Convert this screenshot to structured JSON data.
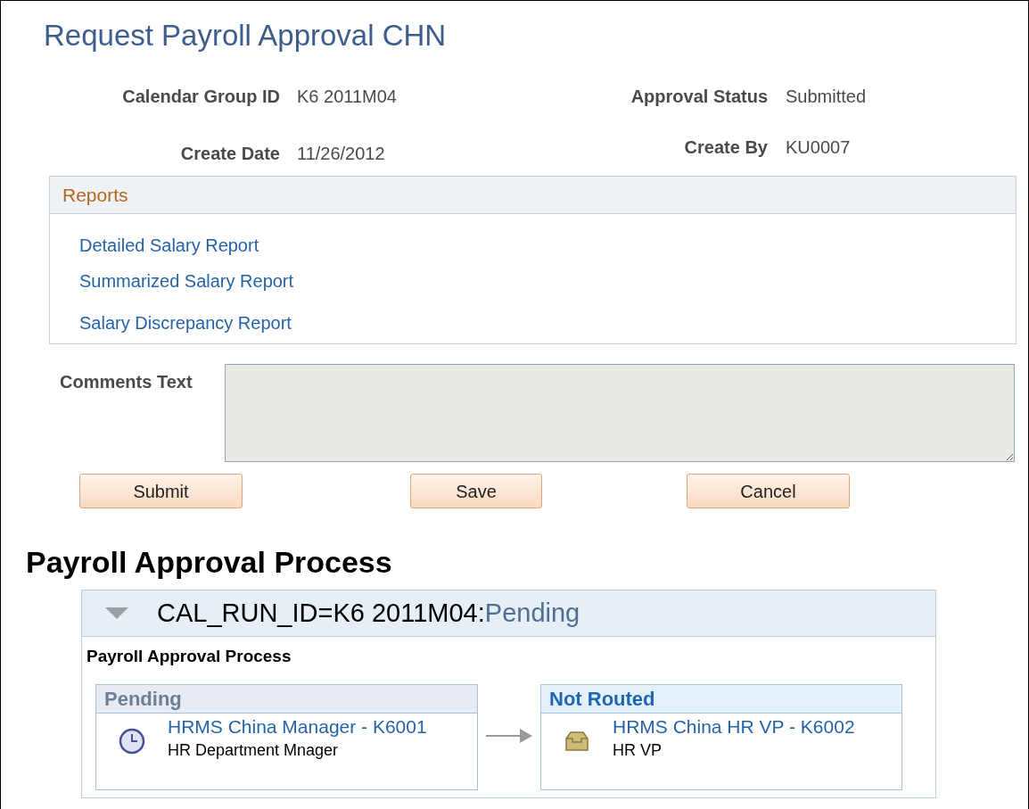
{
  "page_title": "Request Payroll Approval CHN",
  "fields": [
    {
      "label": "Calendar Group ID",
      "value": "K6 2011M04"
    },
    {
      "label": "Approval Status",
      "value": "Submitted"
    },
    {
      "label": "Create Date",
      "value": "11/26/2012"
    },
    {
      "label": "Create By",
      "value": "KU0007"
    }
  ],
  "reports": {
    "title": "Reports",
    "links": [
      "Detailed Salary Report",
      "Summarized Salary Report",
      "Salary Discrepancy Report"
    ]
  },
  "comments": {
    "label": "Comments Text"
  },
  "buttons": [
    "Submit",
    "Save",
    "Cancel"
  ],
  "process": {
    "heading": "Payroll Approval Process",
    "expanded": true,
    "run_label": "CAL_RUN_ID=K6 2011M04:",
    "run_status": "Pending",
    "subheading": "Payroll Approval Process",
    "steps": [
      {
        "kind": "pending",
        "status": "Pending",
        "approver": "HRMS China Manager - K6001",
        "role": "HR Department Mnager"
      },
      {
        "kind": "not_routed",
        "status": "Not Routed",
        "approver": "HRMS China HR VP - K6002",
        "role": "HR VP"
      }
    ]
  }
}
